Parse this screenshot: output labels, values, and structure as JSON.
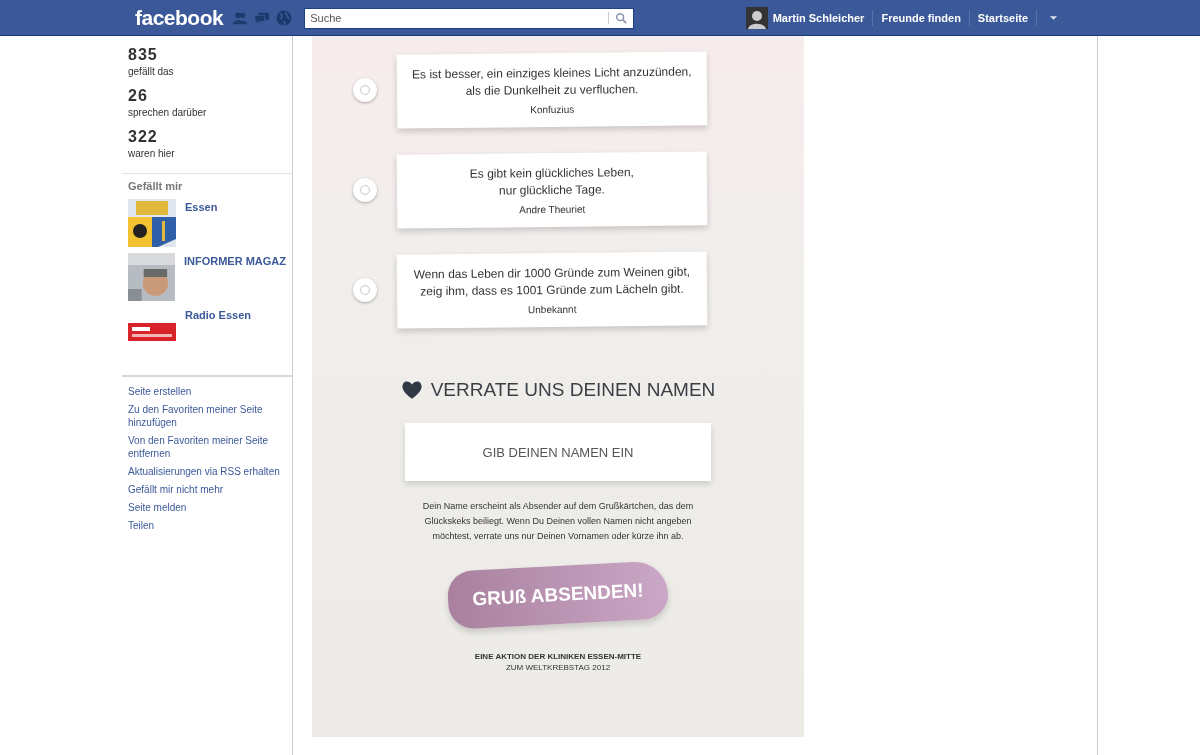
{
  "topbar": {
    "logo": "facebook",
    "search": {
      "placeholder": "Suche"
    },
    "user": "Martin Schleicher",
    "links": [
      "Freunde finden",
      "Startseite"
    ]
  },
  "stats": [
    {
      "count": "835",
      "label": "gefällt das"
    },
    {
      "count": "26",
      "label": "sprechen darüber"
    },
    {
      "count": "322",
      "label": "waren hier"
    }
  ],
  "likes": {
    "title": "Gefällt mir",
    "items": [
      {
        "name": "Essen",
        "kind": "picture"
      },
      {
        "name": "INFORMER MAGAZ",
        "kind": "picture"
      },
      {
        "name": "Radio Essen",
        "kind": "picture"
      }
    ]
  },
  "actions": [
    "Seite erstellen",
    "Zu den Favoriten meiner Seite hinzufügen",
    "Von den Favoriten meiner Seite entfernen",
    "Aktualisierungen via RSS erhalten",
    "Gefällt mir nicht mehr",
    "Seite melden",
    "Teilen"
  ],
  "quotes": [
    {
      "lines": [
        "Es ist besser, ein einziges kleines Licht anzuzünden,",
        "als die Dunkelheit zu verfluchen."
      ],
      "author": "Konfuzius",
      "selected": false
    },
    {
      "lines": [
        "Es gibt kein glückliches Leben,",
        "nur glückliche Tage."
      ],
      "author": "Andre Theuriet",
      "selected": false
    },
    {
      "lines": [
        "Wenn das Leben dir 1000 Gründe zum Weinen gibt,",
        "zeig ihm, dass es 1001 Gründe zum Lächeln gibt."
      ],
      "author": "Unbekannt",
      "selected": false
    }
  ],
  "name_section": {
    "heading": "VERRATE UNS DEINEN NAMEN",
    "placeholder": "GIB DEINEN NAMEN EIN",
    "note": "Dein Name erscheint als Absender auf dem Grußkärtchen, das dem Glückskeks beiliegt. Wenn Du Deinen vollen Namen nicht angeben möchtest, verrate uns nur Deinen Vornamen oder kürze ihn ab.",
    "button": "GRUß ABSENDEN!"
  },
  "footer": [
    "EINE AKTION DER KLINIKEN ESSEN-MITTE",
    "ZUM WELTKREBSTAG 2012"
  ]
}
